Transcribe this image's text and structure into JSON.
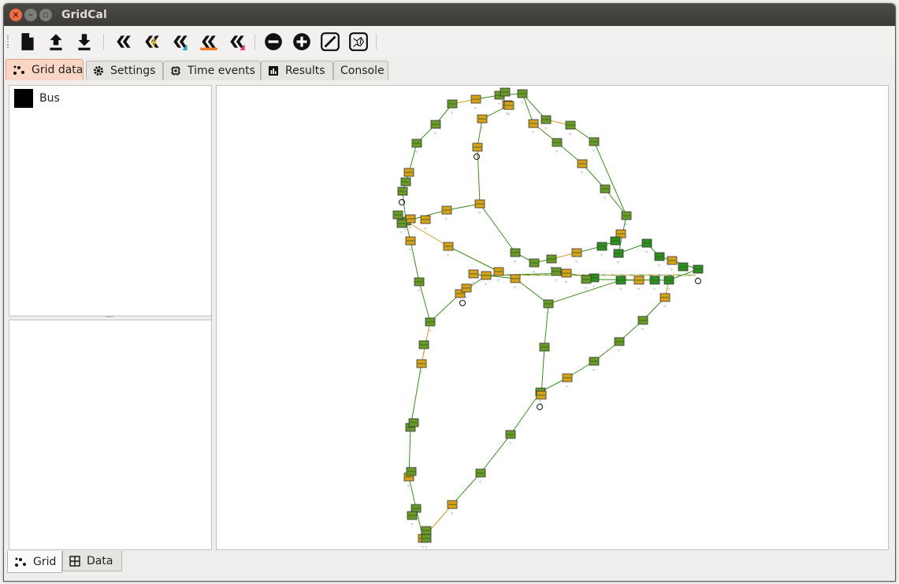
{
  "window": {
    "title": "GridCal"
  },
  "tabs": [
    {
      "label": "Grid data",
      "icon": "grid-nodes-icon"
    },
    {
      "label": "Settings",
      "icon": "gear-icon"
    },
    {
      "label": "Time events",
      "icon": "chip-icon"
    },
    {
      "label": "Results",
      "icon": "bar-chart-icon"
    },
    {
      "label": "Console",
      "icon": ""
    }
  ],
  "toolbar": [
    "new-file-icon",
    "upload-icon",
    "download-icon",
    "power-flow-icon",
    "short-circuit-icon",
    "voltage-stability-icon",
    "time-series-icon",
    "monte-carlo-icon",
    "zoom-out-icon",
    "zoom-in-icon",
    "line-tool-icon",
    "map-icon"
  ],
  "left_panel": {
    "legend": [
      {
        "label": "Bus",
        "color": "#000000"
      }
    ]
  },
  "bottom_tabs": [
    {
      "label": "Grid",
      "icon": "grid-nodes-icon"
    },
    {
      "label": "Data",
      "icon": "table-icon"
    }
  ],
  "colors": {
    "line": "#2e8b1e",
    "bus_green": "#4a9a24",
    "bus_orange": "#d9a21c",
    "accent_tab": "#fbd6c5"
  }
}
